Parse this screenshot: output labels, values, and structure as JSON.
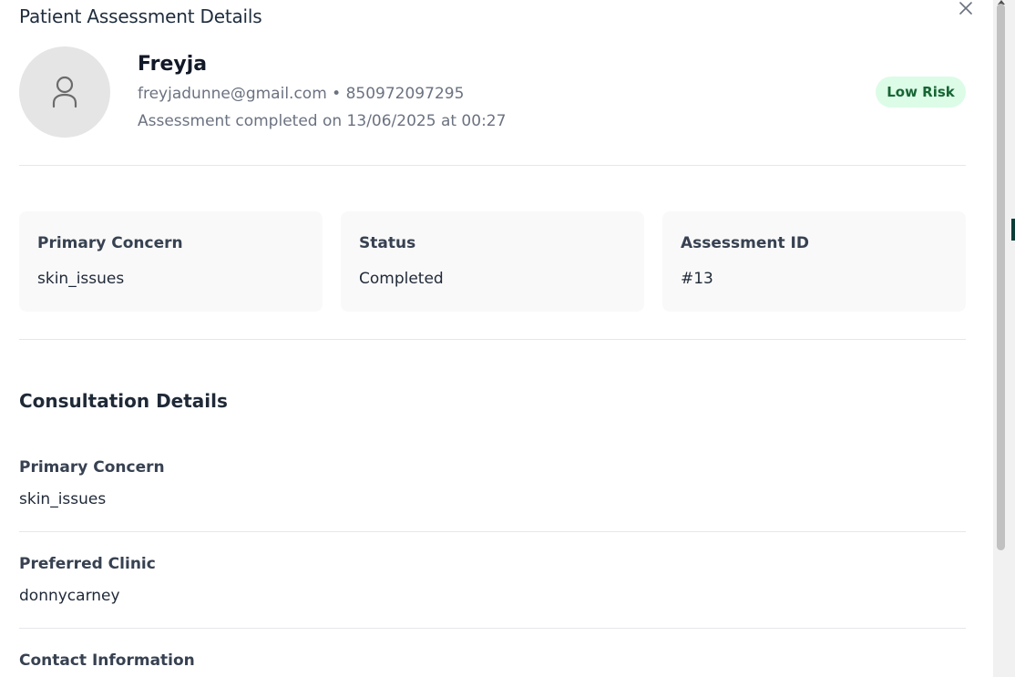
{
  "modal": {
    "title": "Patient Assessment Details"
  },
  "patient": {
    "name": "Freyja",
    "contact": "freyjadunne@gmail.com • 850972097295",
    "assessment_date": "Assessment completed on 13/06/2025 at 00:27",
    "risk": "Low Risk"
  },
  "cards": [
    {
      "label": "Primary Concern",
      "value": "skin_issues"
    },
    {
      "label": "Status",
      "value": "Completed"
    },
    {
      "label": "Assessment ID",
      "value": "#13"
    }
  ],
  "consultation": {
    "title": "Consultation Details",
    "items": [
      {
        "label": "Primary Concern",
        "value": "skin_issues"
      },
      {
        "label": "Preferred Clinic",
        "value": "donnycarney"
      },
      {
        "label": "Contact Information",
        "value": ""
      }
    ]
  },
  "icons": {
    "close": "close-icon",
    "avatar": "user-icon"
  },
  "colors": {
    "risk_badge_bg": "#dcfce7",
    "risk_badge_text": "#166534",
    "card_bg": "#f9f9f9"
  }
}
